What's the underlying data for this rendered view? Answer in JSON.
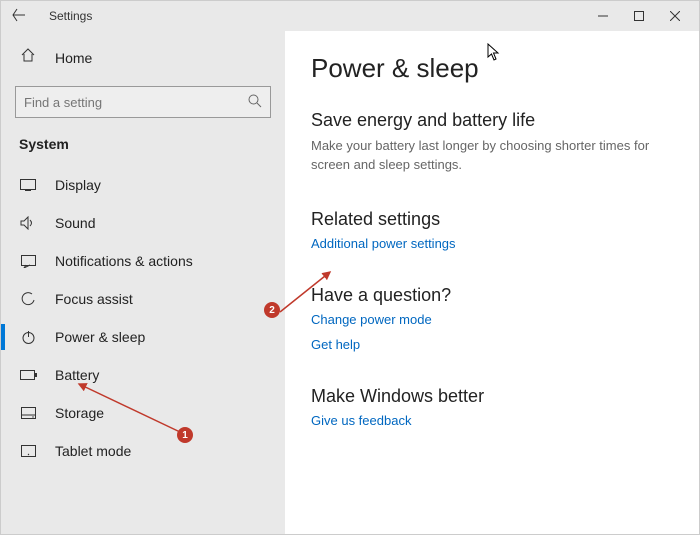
{
  "window": {
    "title": "Settings"
  },
  "sidebar": {
    "home_label": "Home",
    "search_placeholder": "Find a setting",
    "category": "System",
    "selected_index": 4,
    "items": [
      {
        "label": "Display"
      },
      {
        "label": "Sound"
      },
      {
        "label": "Notifications & actions"
      },
      {
        "label": "Focus assist"
      },
      {
        "label": "Power & sleep"
      },
      {
        "label": "Battery"
      },
      {
        "label": "Storage"
      },
      {
        "label": "Tablet mode"
      }
    ]
  },
  "content": {
    "page_title": "Power & sleep",
    "energy": {
      "heading": "Save energy and battery life",
      "desc": "Make your battery last longer by choosing shorter times for screen and sleep settings."
    },
    "related": {
      "heading": "Related settings",
      "link1": "Additional power settings"
    },
    "question": {
      "heading": "Have a question?",
      "link1": "Change power mode",
      "link2": "Get help"
    },
    "better": {
      "heading": "Make Windows better",
      "link1": "Give us feedback"
    }
  },
  "annotations": {
    "badge1": "1",
    "badge2": "2",
    "arrow_color": "#c0392b"
  }
}
